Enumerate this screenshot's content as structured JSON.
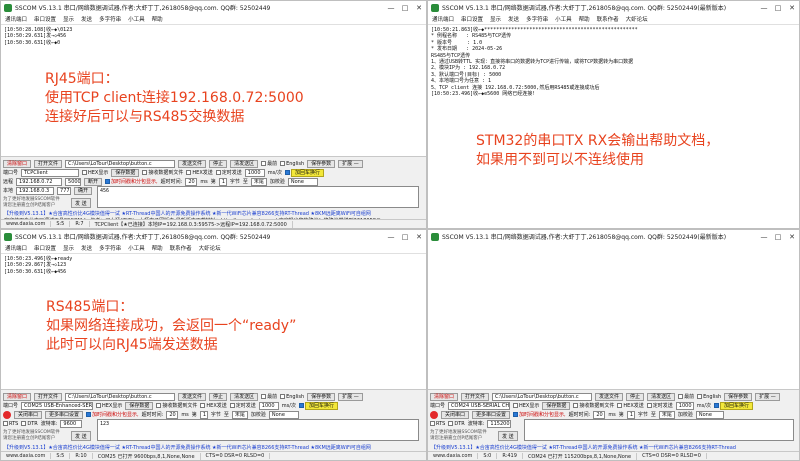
{
  "windows": {
    "tl": {
      "title": "SSCOM V5.13.1 串口/网络数据调试器,作者:大虾丁丁,2618058@qq.com. QQ群: 52502449",
      "menu": [
        "通讯端口",
        "串口设置",
        "显示",
        "发送",
        "多字符串",
        "小工具",
        "帮助"
      ],
      "lines": [
        "[10:50:28.108]收←◆\\0123",
        "",
        "[10:50:29.631]发→◇456",
        "",
        "[10:50:30.631]收←◆0"
      ],
      "panel": {
        "open_file": "打开文件",
        "file_path": "C:\\Users\\LoTour\\Desktop\\button.c",
        "send_file": "发送文件",
        "stop": "停止",
        "clear_send": "清发送区",
        "front": "最前",
        "english": "English",
        "save_params": "保存参数",
        "expand": "扩展 —",
        "port_label": "端口号",
        "port_value": "TCPClient",
        "hex_display": "HEX显示",
        "save_data": "保存数据",
        "recv_to_file": "接收数据到文件",
        "hex_send": "HEX发送",
        "timed_send": "定时发送",
        "interval_ms": "1000",
        "ms_label": "ms/次",
        "add_crlf": "加回车换行",
        "remote_label": "远程",
        "remote_ip": "192.168.0.72",
        "remote_port": "5000",
        "disconnect": "断开",
        "timestamp_label": "加时间戳和分包显示,",
        "timeout_label": "超时时间:",
        "timeout_value": "20",
        "timeout_ms": "ms",
        "nth_label": "第",
        "nth_value": "1",
        "byte_label": "字节",
        "to_label": "至",
        "end_label": "末尾",
        "checksum_label": "加校验",
        "checksum_value": "None",
        "local_label": "本地",
        "local_ip": "192.168.0.3",
        "local_port": "777",
        "expand_btn": "确开",
        "send_text": "456",
        "tip1": "为了更好地发展SSCOM软件",
        "tip2": "请您注册嘉立创P结尾客户",
        "send_btn": "发 送",
        "ad1": "【升级到V5.13.1】★合宙高性价比4G模块值得一试 ★RT-Thread中国人的开源免费操作系统 ★新一代WiFi芯片兼容8266支持RT-Thread ★8KM远距离WiFi可自组网",
        "ad2": "欢迎使用专业串口调试工具SSCOM ！ 作者：习小猛(丁丁)，大虾电子网版主  最新版本下载地址：http://www.daxia.com/  欢迎提出您的建议！将建议发送到2618058@qq.com"
      },
      "status": [
        "www.daxia.com",
        "S:5",
        "R:7",
        "TCPClient【★已连接】本地IP=192.168.0.3:59575->远程IP=192.168.0.72:5000"
      ]
    },
    "tr": {
      "title": "SSCOM V5.13.1 串口/网络数据调试器,作者:大虾丁丁,2618058@qq.com. QQ群: 52502449(最新版本)",
      "menu": [
        "通讯端口",
        "串口设置",
        "显示",
        "发送",
        "多字符串",
        "小工具",
        "帮助",
        "联系作者",
        "大虾论坛"
      ],
      "lines": [
        "[10:50:21.863]收←◆***************************************************",
        "* 例程名称   : RS485与TCP透传",
        "* 版本号     : 1.0",
        "* 发布日期   : 2024-05-26",
        "RS485与TCP透传",
        "1、通过USB转TTL 实现：直接将串口的数据转为TCP进行传输，或将TCP数据转为串口数据",
        "2、模块IP为 : 192.168.0.72",
        "3、默认端口号(目标) : 5000",
        "4、本地端口号为任意 : 1",
        "5、TCP client 连接 192.168.0.72:5000,然后用RS485或连接成功后",
        "",
        "[10:50:23.496]收←◆e5600 网络已经连接!"
      ],
      "status": []
    },
    "bl": {
      "title": "SSCOM V5.13.1 串口/网络数据调试器,作者:大虾丁丁,2618058@qq.com. QQ群: 52502449",
      "menu": [
        "通讯端口",
        "串口设置",
        "显示",
        "发送",
        "多字符串",
        "小工具",
        "帮助",
        "联系作者",
        "大虾论坛"
      ],
      "lines": [
        "[10:50:23.496]收←◆ready",
        "[10:50:29.867]发→◇123",
        "",
        "[10:50:30.631]收←◆456"
      ],
      "panel": {
        "open_file": "打开文件",
        "file_path": "C:\\Users\\LoTour\\Desktop\\button.c",
        "send_file": "发送文件",
        "stop": "停止",
        "clear_send": "清发送区",
        "front": "最前",
        "english": "English",
        "save_params": "保存参数",
        "expand": "扩展 —",
        "port_label": "端口号",
        "port_value": "COM25 USB-Enhanced-SERIAL",
        "hex_display": "HEX显示",
        "save_data": "保存数据",
        "recv_to_file": "接收数据到文件",
        "hex_send": "HEX发送",
        "timed_send": "定时发送",
        "interval_ms": "1000",
        "ms_label": "ms/次",
        "add_crlf": "加回车换行",
        "close_port": "关闭串口",
        "more_settings": "更多串口设置",
        "timestamp_label": "加时间戳和分包显示,",
        "timeout_label": "超时时间:",
        "timeout_value": "20",
        "timeout_ms": "ms",
        "nth_label": "第",
        "nth_value": "1",
        "byte_label": "字节",
        "to_label": "至",
        "end_label": "末尾",
        "checksum_label": "加校验",
        "checksum_value": "None",
        "rts": "RTS",
        "dtr": "DTR",
        "baud_label": "波特率:",
        "baud_value": "9600",
        "send_text": "123",
        "tip1": "为了更好地发展SSCOM软件",
        "tip2": "请您注册嘉立创P结尾客户",
        "send_btn": "发 送",
        "ad1": "【升级到V5.13.1】★合宙高性价比4G模块值得一试 ★RT-Thread中国人的开源免费操作系统 ★新一代WiFi芯片兼容8266支持RT-Thread ★8KM远距离WiFi可自组网"
      },
      "status": [
        "www.daxia.com",
        "S:5",
        "R:10",
        "COM25 已打开  9600bps,8,1,None,None",
        "CTS=0 DSR=0 RLSD=0"
      ]
    },
    "br": {
      "title": "SSCOM V5.13.1 串口/网络数据调试器,作者:大虾丁丁,2618058@qq.com. QQ群: 52502449(最新版本)",
      "panel": {
        "open_file": "打开文件",
        "file_path": "C:\\Users\\LoTour\\Desktop\\button.c",
        "send_file": "发送文件",
        "stop": "停止",
        "clear_send": "清发送区",
        "front": "最前",
        "english": "English",
        "save_params": "保存参数",
        "expand": "扩展 —",
        "port_label": "端口号",
        "port_value": "COM24 USB-SERIAL CH340",
        "hex_display": "HEX显示",
        "save_data": "保存数据",
        "recv_to_file": "接收数据到文件",
        "hex_send": "HEX发送",
        "timed_send": "定时发送",
        "interval_ms": "1000",
        "ms_label": "ms/次",
        "add_crlf": "加回车换行",
        "close_port": "关闭串口",
        "more_settings": "更多串口设置",
        "timestamp_label": "加时间戳和分包显示,",
        "timeout_label": "超时时间:",
        "timeout_value": "20",
        "timeout_ms": "ms",
        "nth_label": "第",
        "nth_value": "1",
        "byte_label": "字节",
        "to_label": "至",
        "end_label": "末尾",
        "checksum_label": "加校验",
        "checksum_value": "None",
        "rts": "RTS",
        "dtr": "DTR",
        "baud_label": "波特率:",
        "baud_value": "115200",
        "send_text": "",
        "tip1": "为了更好地发展SSCOM软件",
        "tip2": "请您注册嘉立创P结尾客户",
        "send_btn": "发 送",
        "ad1": "【升级到V5.13.1】★合宙高性价比4G模块值得一试 ★RT-Thread中国人的开源免费操作系统 ★新一代WiFi芯片兼容8266支持RT-Thread"
      },
      "status": [
        "www.daxia.com",
        "S:0",
        "R:419",
        "COM24 已打开  115200bps,8,1,None,None",
        "CTS=0 DSR=0 RLSD=0"
      ]
    }
  },
  "annotations": {
    "rj45": [
      "RJ45端口：",
      "使用TCP client连接192.168.0.72:5000",
      "连接好后可以与RS485交换数据"
    ],
    "stm32": [
      "STM32的串口TX RX会输出帮助文档，",
      "如果用不到可以不连线使用"
    ],
    "rs485": [
      "RS485端口：",
      "如果网络连接成功，会返回一个“ready”",
      "此时可以向RJ45端发送数据"
    ]
  },
  "colors": {
    "annotation": "#e8431f",
    "open_button": "#1fbf3f",
    "add_crlf_button": "#f3e83a",
    "close_port_dot": "#e3282a"
  }
}
